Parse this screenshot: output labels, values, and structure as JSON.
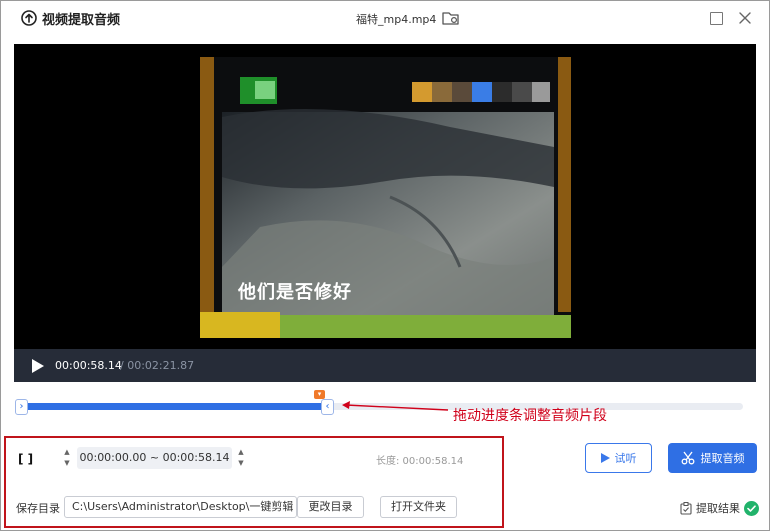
{
  "app": {
    "title": "视频提取音频",
    "file_name": "福特_mp4.mp4"
  },
  "player": {
    "subtitle": "他们是否修好",
    "current_time": "00:00:58.14",
    "total_time": "/ 00:02:21.87"
  },
  "timeline": {
    "progress": 0.41,
    "annotation": "拖动进度条调整音频片段"
  },
  "controls": {
    "bracket_label": "[ ]",
    "range": "00:00:00.00 ~ 00:00:58.14",
    "duration": "长度: 00:00:58.14",
    "preview_label": "试听",
    "extract_label": "提取音频"
  },
  "output": {
    "save_label": "保存目录",
    "path": "C:\\Users\\Administrator\\Desktop\\一键剪辑",
    "change_dir_label": "更改目录",
    "open_folder_label": "打开文件夹",
    "result_label": "提取结果"
  },
  "colors": {
    "accent": "#2f6fe4",
    "annotation": "#d0021b",
    "success": "#21b36b",
    "playhead": "#f07a2a"
  }
}
